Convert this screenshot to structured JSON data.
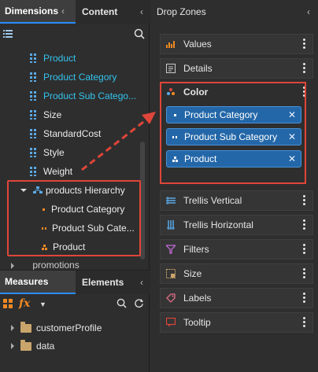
{
  "left_tabs": {
    "dimensions": "Dimensions",
    "content": "Content"
  },
  "tree": {
    "items": [
      {
        "label": "Product"
      },
      {
        "label": "Product Category"
      },
      {
        "label": "Product Sub Catego..."
      },
      {
        "label": "Size"
      },
      {
        "label": "StandardCost"
      },
      {
        "label": "Style"
      },
      {
        "label": "Weight"
      }
    ],
    "hierarchy": {
      "label": "products Hierarchy",
      "levels": [
        {
          "label": "Product Category"
        },
        {
          "label": "Product Sub Cate..."
        },
        {
          "label": "Product"
        }
      ]
    },
    "cut_off": "promotions"
  },
  "bottom_tabs": {
    "measures": "Measures",
    "elements": "Elements"
  },
  "folders": [
    {
      "label": "customerProfile"
    },
    {
      "label": "data"
    }
  ],
  "drop_zones": {
    "title": "Drop Zones",
    "zones": {
      "values": "Values",
      "details": "Details",
      "color": "Color",
      "trellis_vertical": "Trellis Vertical",
      "trellis_horizontal": "Trellis Horizontal",
      "filters": "Filters",
      "size": "Size",
      "labels": "Labels",
      "tooltip": "Tooltip"
    },
    "color_chips": [
      {
        "label": "Product Category"
      },
      {
        "label": "Product Sub Category"
      },
      {
        "label": "Product"
      }
    ]
  },
  "colors": {
    "accent_blue": "#2367a8",
    "highlight_red": "#e0453a",
    "cyan_text": "#33c3ee",
    "fx_orange": "#f08a24"
  }
}
